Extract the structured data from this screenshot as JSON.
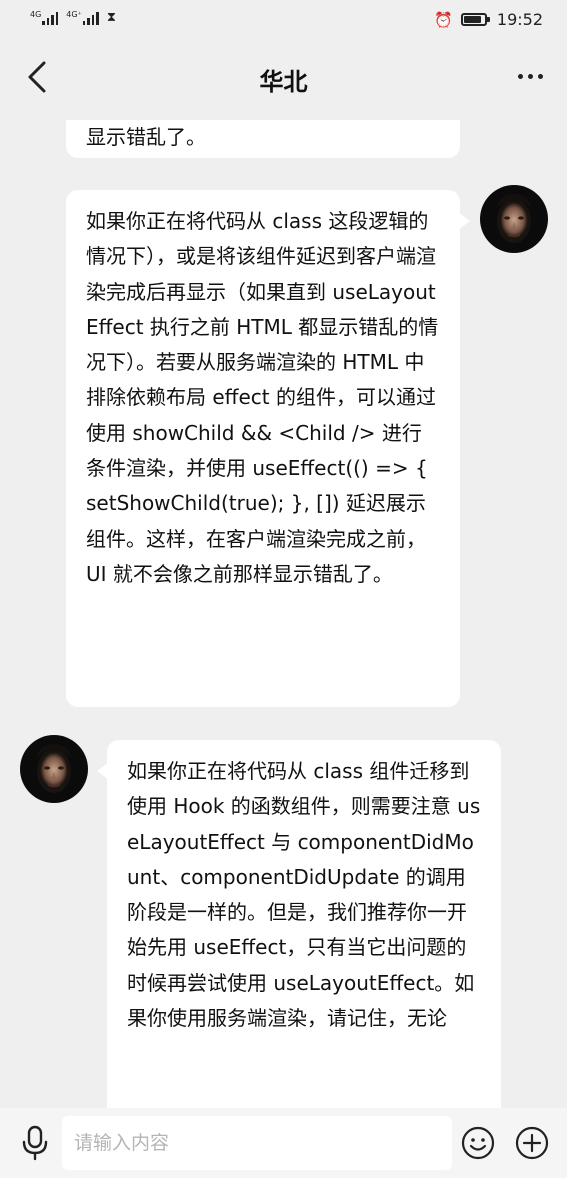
{
  "status_bar": {
    "net_1": "4G",
    "net_2": "4G⁺",
    "time": "19:52",
    "battery_level": 0.85,
    "icons": [
      "signal-icon",
      "signal-icon",
      "hourglass-icon",
      "alarm-icon",
      "battery-icon"
    ]
  },
  "nav": {
    "title": "华北",
    "icons": [
      "back-arrow-icon",
      "more-icon"
    ]
  },
  "messages": [
    {
      "side": "right",
      "text": "显示错乱了。"
    },
    {
      "side": "right",
      "text": "如果你正在将代码从 class 这段逻辑的情况下），或是将该组件延迟到客户端渲染完成后再显示（如果直到 useLayoutEffect 执行之前 HTML 都显示错乱的情况下）。若要从服务端渲染的 HTML 中排除依赖布局 effect 的组件，可以通过使用 showChild && <Child /> 进行条件渲染，并使用 useEffect(() => { setShowChild(true); }, []) 延迟展示组件。这样，在客户端渲染完成之前，UI 就不会像之前那样显示错乱了。"
    },
    {
      "side": "left",
      "text": "如果你正在将代码从 class 组件迁移到使用 Hook 的函数组件，则需要注意 useLayoutEffect 与 componentDidMount、componentDidUpdate 的调用阶段是一样的。但是，我们推荐你一开始先用 useEffect，只有当它出问题的时候再尝试使用 useLayoutEffect。如果你使用服务端渲染，请记住，无论"
    }
  ],
  "input_bar": {
    "placeholder": "请输入内容",
    "value": "",
    "icons": [
      "microphone-icon",
      "emoji-icon",
      "plus-icon"
    ]
  }
}
